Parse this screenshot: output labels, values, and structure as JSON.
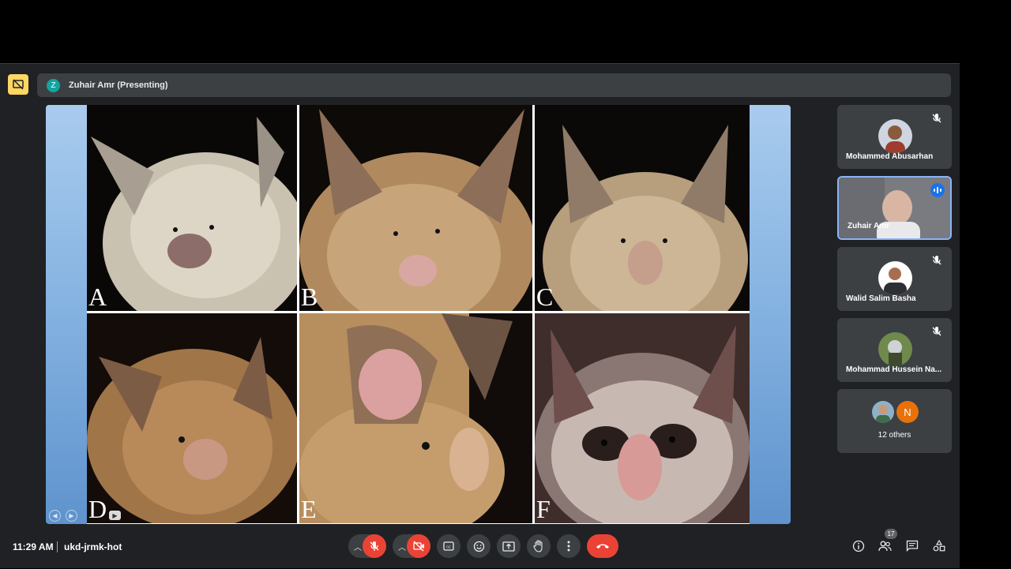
{
  "presenter": {
    "initial": "Z",
    "label": "Zuhair Amr (Presenting)",
    "avatar_color": "#12a4a0"
  },
  "slide": {
    "panels": [
      {
        "label": "A"
      },
      {
        "label": "B"
      },
      {
        "label": "C"
      },
      {
        "label": "D"
      },
      {
        "label": "E"
      },
      {
        "label": "F"
      }
    ]
  },
  "participants": [
    {
      "name": "Mohammed Abusarhan",
      "muted": true
    },
    {
      "name": "Zuhair Amr",
      "speaking": true
    },
    {
      "name": "Walid Salim Basha",
      "muted": true
    },
    {
      "name": "Mohammad Hussein Na...",
      "muted": true
    }
  ],
  "others": {
    "initial": "N",
    "label": "12 others",
    "initial_color": "#e8710a"
  },
  "footer": {
    "time": "11:29 AM",
    "meeting_code": "ukd-jrmk-hot",
    "participant_count": "17"
  },
  "icons": {
    "present": "stop-presenting-icon",
    "mic": "mic-off-icon",
    "camera": "camera-off-icon",
    "captions": "captions-icon",
    "emoji": "emoji-icon",
    "share": "present-screen-icon",
    "hand": "raise-hand-icon",
    "more": "more-options-icon",
    "end": "end-call-icon",
    "info": "info-icon",
    "people": "people-icon",
    "chat": "chat-icon",
    "activities": "activities-icon"
  },
  "colors": {
    "accent_blue": "#8ab4f8",
    "danger_red": "#ea4335",
    "present_yellow": "#fdd663",
    "surface": "#202124"
  }
}
